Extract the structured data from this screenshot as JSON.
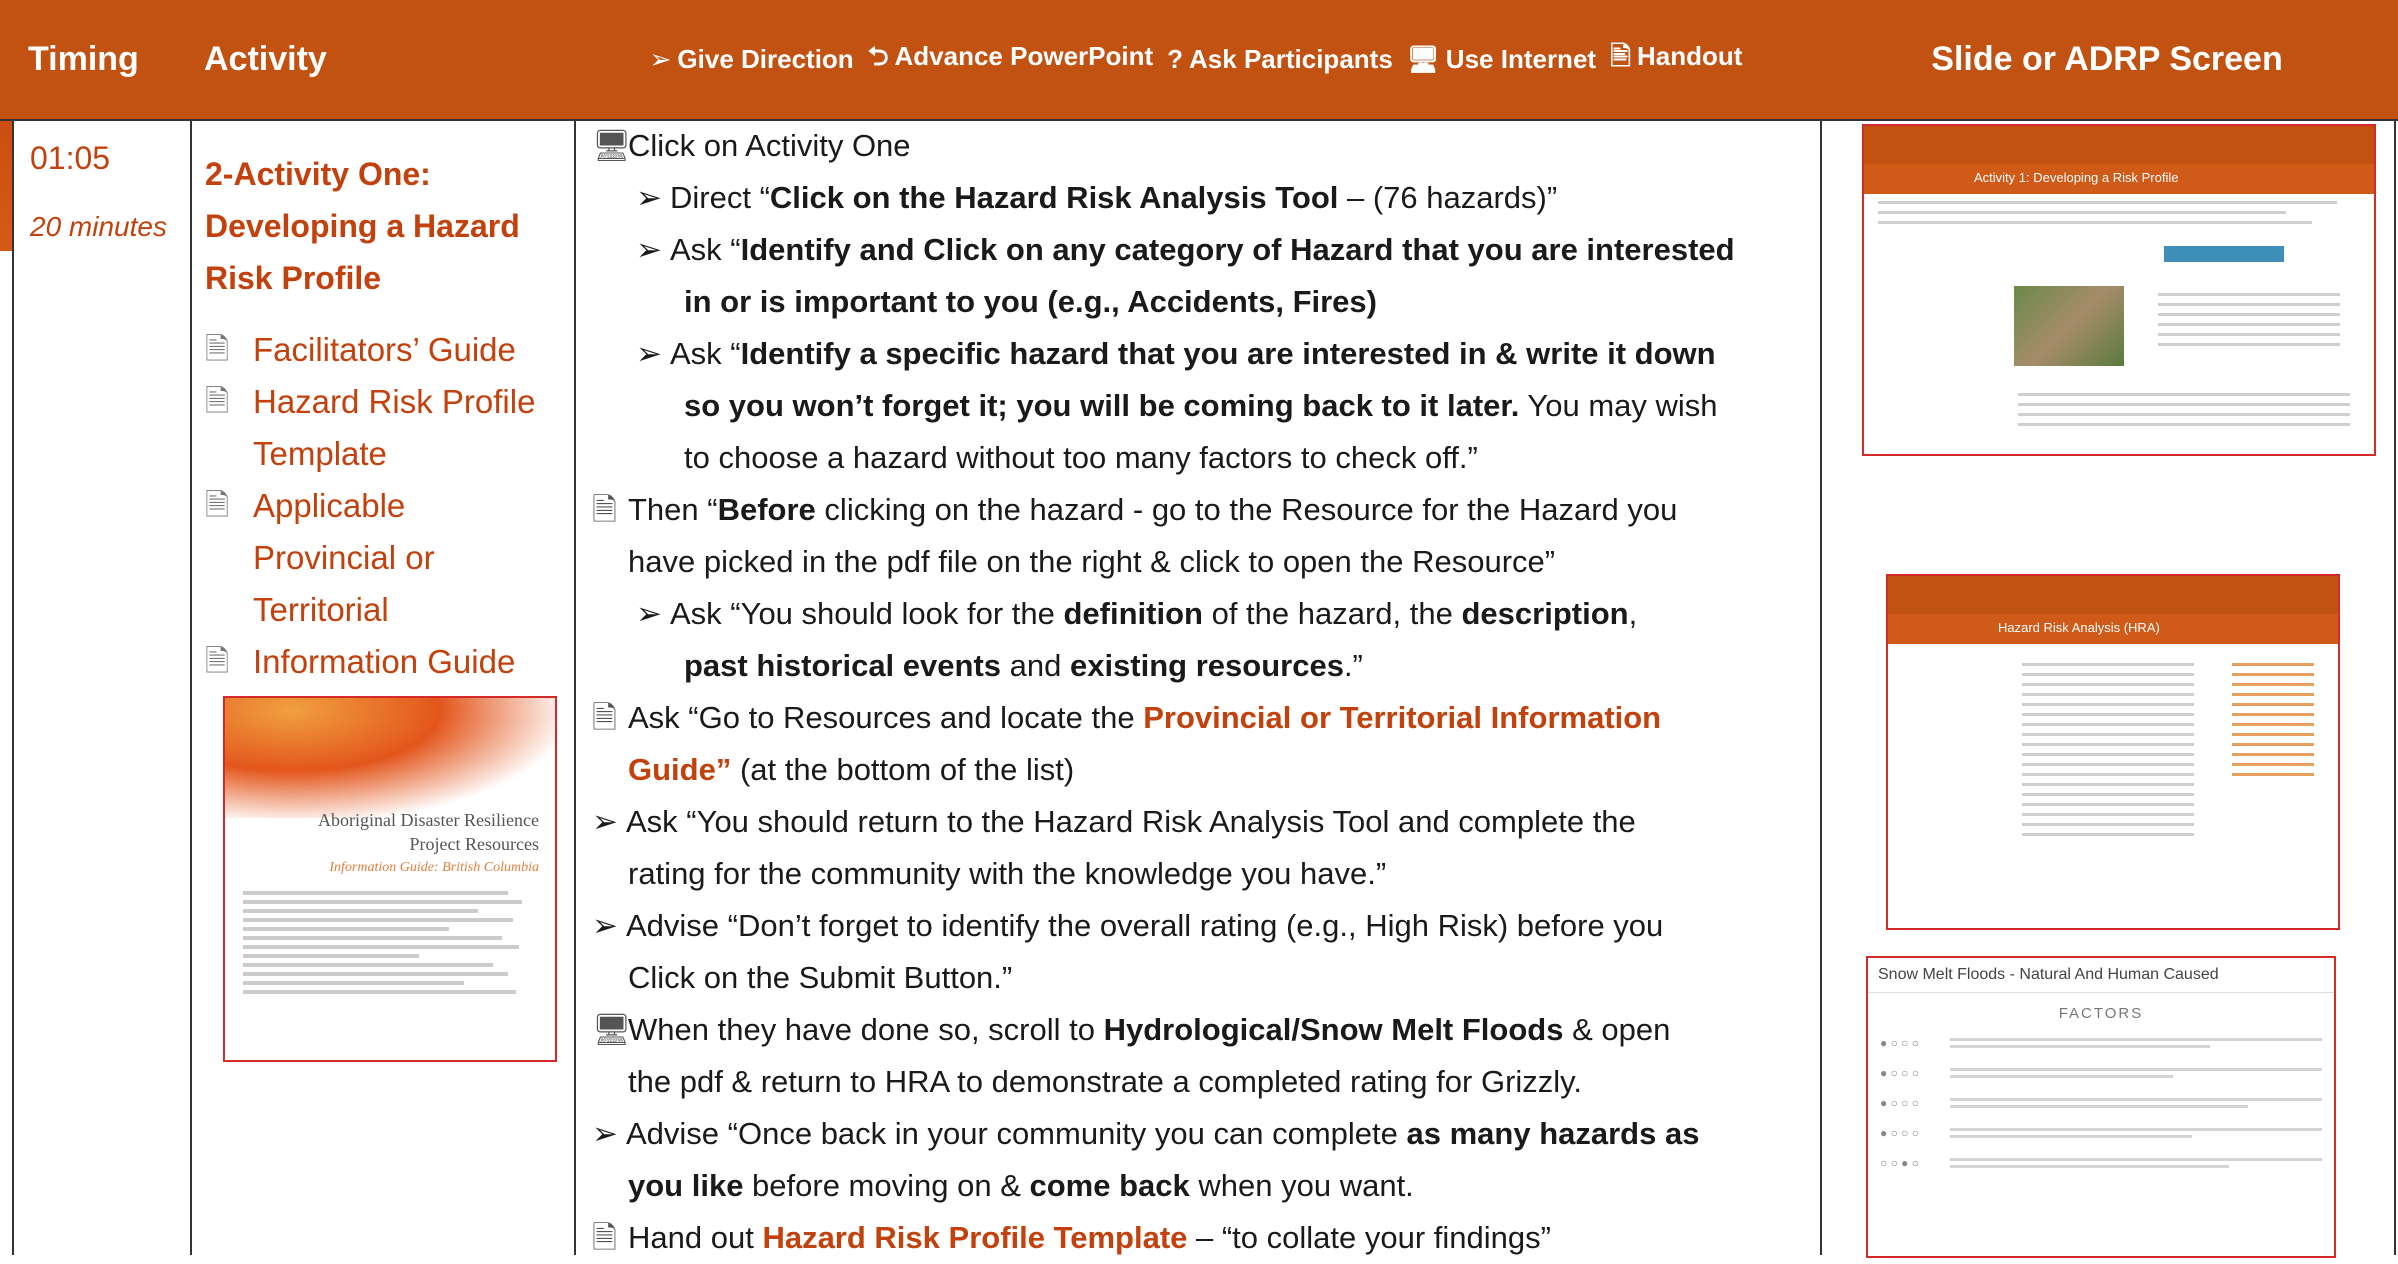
{
  "header": {
    "timing": "Timing",
    "activity": "Activity",
    "legend": [
      {
        "symbol": "➢",
        "label": "Give Direction"
      },
      {
        "symbol": "⮌",
        "label": "Advance PowerPoint"
      },
      {
        "symbol": "?",
        "label": "Ask Participants"
      },
      {
        "symbol": "🖥",
        "label": "Use Internet"
      },
      {
        "symbol": "🖹",
        "label": "Handout"
      }
    ],
    "slide": "Slide or ADRP Screen"
  },
  "timing": {
    "time": "01:05",
    "duration": "20 minutes"
  },
  "activity": {
    "title_lines": [
      "2-Activity One:",
      "Developing a Hazard",
      "Risk Profile"
    ],
    "resources": [
      {
        "lines": [
          "Facilitators’ Guide"
        ]
      },
      {
        "lines": [
          "Hazard Risk Profile",
          "Template"
        ]
      },
      {
        "lines": [
          "Applicable",
          "Provincial or",
          "Territorial"
        ]
      },
      {
        "lines": [
          "Information Guide"
        ]
      }
    ],
    "guide_thumb": {
      "title_1": "Aboriginal Disaster Resilience",
      "title_2": "Project Resources",
      "subtitle": "Information Guide: British Columbia"
    }
  },
  "instructions": {
    "l1": "Click on Activity One",
    "l2a": "Direct “",
    "l2b": "Click on the Hazard Risk Analysis Tool",
    "l2c": " – (76 hazards)”",
    "l3a": "Ask “",
    "l3b": "Identify and Click on any category of Hazard that you are interested",
    "l4": "in or is important to you (e.g., Accidents, Fires)",
    "l5a": "Ask “",
    "l5b": "Identify a specific hazard that you are interested in & write it down",
    "l6a": "so you won’t forget it; you will be coming back to it later.",
    "l6b": " You may wish",
    "l7": "to choose a hazard without too many factors to check off.”",
    "l8a": "Then “",
    "l8b": "Before",
    "l8c": " clicking on the hazard - go to the Resource for the Hazard you",
    "l9": "have picked in the pdf file on the right & click to open the Resource”",
    "l10a": "Ask “You should look for the ",
    "l10b": "definition",
    "l10c": " of the hazard, the ",
    "l10d": "description",
    "l10e": ",",
    "l11a": "past historical events",
    "l11b": " and ",
    "l11c": "existing resources",
    "l11d": ".”",
    "l12a": "Ask “Go to Resources and locate the ",
    "l12b": "Provincial or Territorial Information",
    "l13a": "Guide”",
    "l13b": " (at the bottom of the list)",
    "l14": "Ask “You should return to the Hazard Risk Analysis Tool and complete the",
    "l15": "rating for the community with the knowledge you have.”",
    "l16": "Advise “Don’t forget to identify the overall rating (e.g., High Risk) before you",
    "l17": "Click on the Submit Button.”",
    "l18a": "When they have done so, scroll to ",
    "l18b": "Hydrological/Snow Melt Floods",
    "l18c": " & open",
    "l19": "the pdf & return to HRA to demonstrate a completed rating for Grizzly.",
    "l20a": "Advise “Once back in your community you can complete ",
    "l20b": "as many hazards as",
    "l21a": "you like",
    "l21b": " before moving on & ",
    "l21c": "come back",
    "l21d": " when you want.",
    "l22a": "Hand out ",
    "l22b": "Hazard Risk Profile Template",
    "l22c": " – “to collate your findings”"
  },
  "slides": {
    "s1_title": "Activity 1: Developing a Risk Profile",
    "s2_title": "Hazard Risk Analysis (HRA)",
    "s3_title": "Snow Melt Floods - Natural And Human Caused",
    "s3_factors": "FACTORS"
  },
  "colors": {
    "header_bg": "#c25212",
    "accent": "#c2410c",
    "thumb_border": "#d42a2a"
  }
}
